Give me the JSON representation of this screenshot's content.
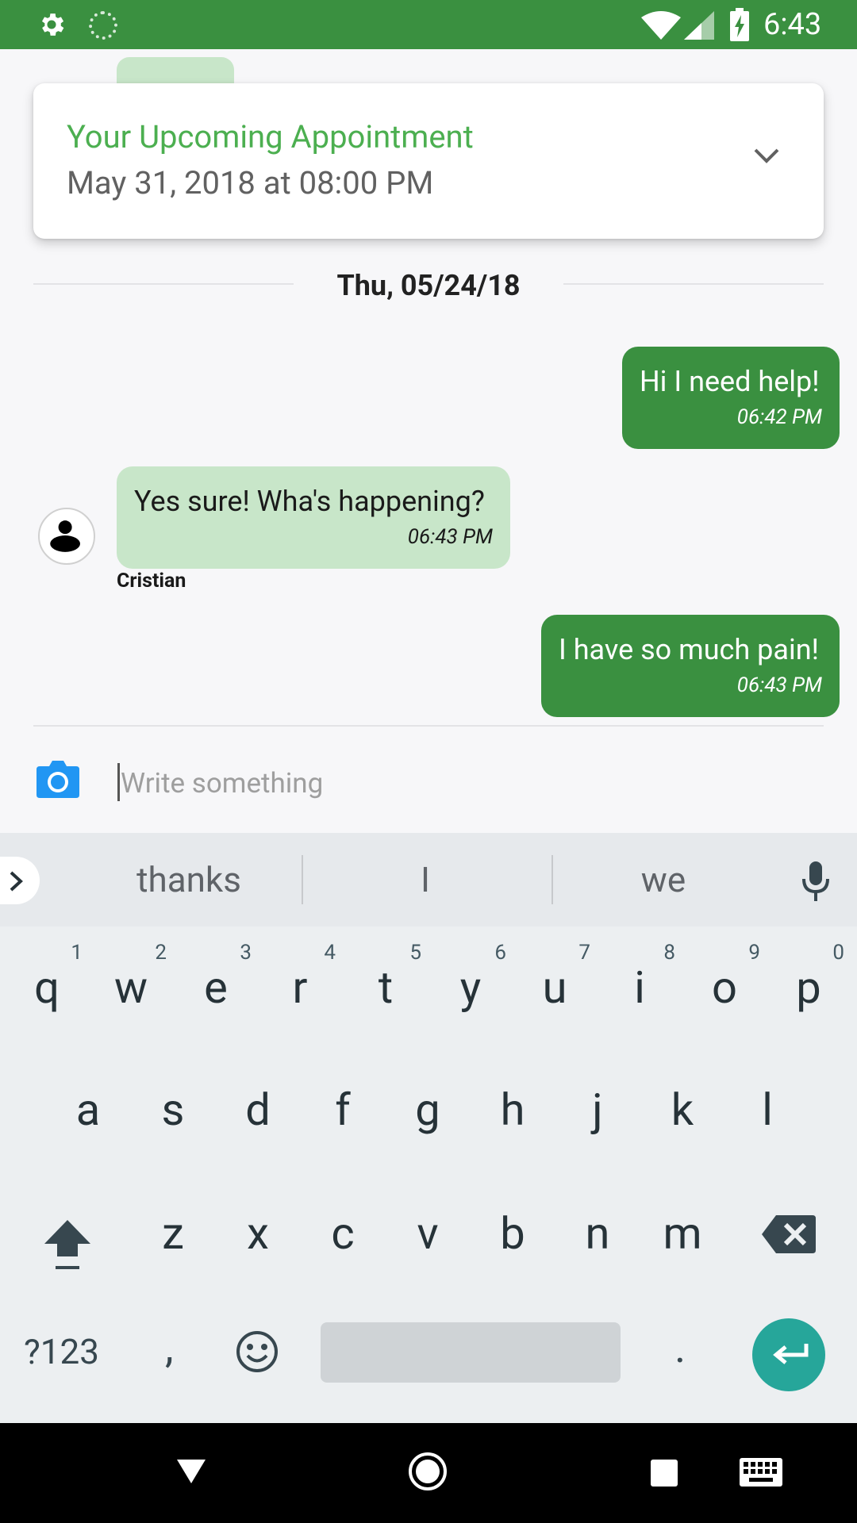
{
  "status_bar": {
    "time": "6:43",
    "icons": [
      "gear-icon",
      "loading-icon",
      "wifi-icon",
      "signal-icon",
      "battery-charging-icon"
    ],
    "bg_color": "#3a9040"
  },
  "appointment": {
    "title": "Your Upcoming Appointment",
    "datetime": "May 31, 2018 at 08:00 PM",
    "expand_icon": "chevron-down-icon",
    "title_color": "#4caf50"
  },
  "chat": {
    "date_label": "Thu, 05/24/18",
    "messages": [
      {
        "direction": "outgoing",
        "text": "Hi I need help!",
        "time": "06:42 PM"
      },
      {
        "direction": "incoming",
        "text": "Yes sure! Wha's happening?",
        "time": "06:43 PM",
        "sender": "Cristian"
      },
      {
        "direction": "outgoing",
        "text": "I have so much pain!",
        "time": "06:43 PM"
      }
    ],
    "outgoing_color": "#3a9040",
    "incoming_color": "#c8e6c9"
  },
  "composer": {
    "placeholder": "Write something",
    "value": "",
    "camera_icon": "camera-icon"
  },
  "keyboard": {
    "suggestions": [
      "thanks",
      "I",
      "we"
    ],
    "row1": [
      {
        "key": "q",
        "hint": "1"
      },
      {
        "key": "w",
        "hint": "2"
      },
      {
        "key": "e",
        "hint": "3"
      },
      {
        "key": "r",
        "hint": "4"
      },
      {
        "key": "t",
        "hint": "5"
      },
      {
        "key": "y",
        "hint": "6"
      },
      {
        "key": "u",
        "hint": "7"
      },
      {
        "key": "i",
        "hint": "8"
      },
      {
        "key": "o",
        "hint": "9"
      },
      {
        "key": "p",
        "hint": "0"
      }
    ],
    "row2": [
      "a",
      "s",
      "d",
      "f",
      "g",
      "h",
      "j",
      "k",
      "l"
    ],
    "row3": [
      "z",
      "x",
      "c",
      "v",
      "b",
      "n",
      "m"
    ],
    "symbols_label": "?123",
    "comma": ",",
    "period": ".",
    "enter_color": "#26a69a"
  },
  "nav_bar": {
    "icons": [
      "back-icon",
      "home-icon",
      "recents-icon",
      "keyboard-switch-icon"
    ]
  }
}
